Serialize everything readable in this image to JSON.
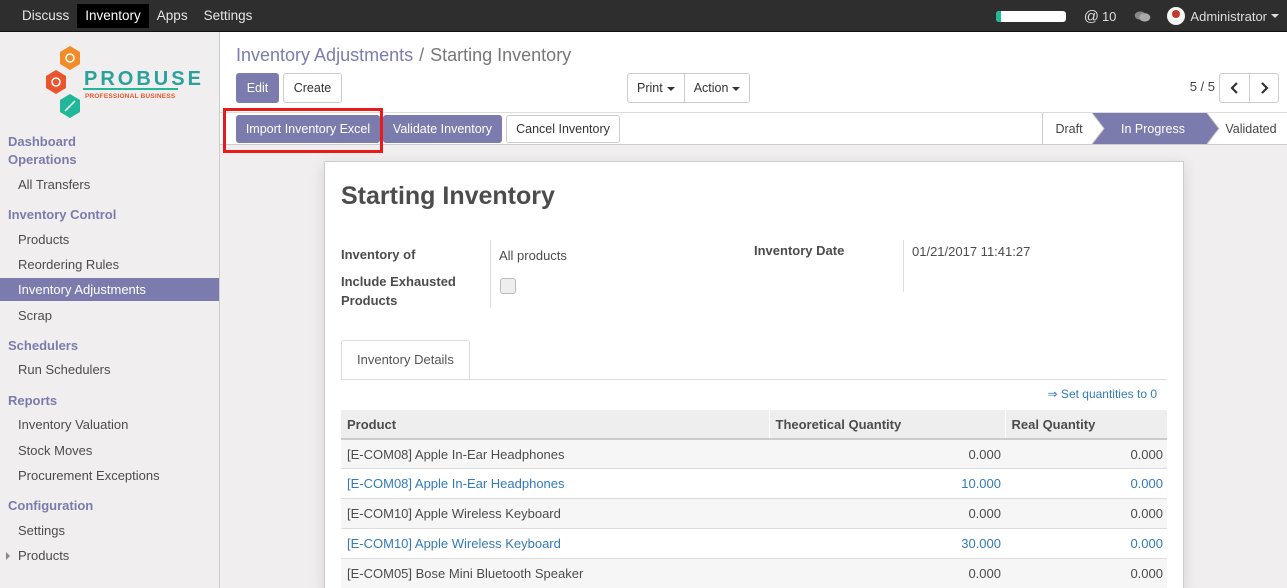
{
  "topbar": {
    "menu": [
      "Discuss",
      "Inventory",
      "Apps",
      "Settings"
    ],
    "active_menu": "Inventory",
    "progress_fraction": 0.08,
    "mentions_count": "10",
    "user_name": "Administrator"
  },
  "logo": {
    "name": "PROBUSE",
    "tagline": "PROFESSIONAL BUSINESS"
  },
  "sidebar": {
    "dashboard_heading": "Dashboard",
    "operations_heading": "Operations",
    "all_transfers": "All Transfers",
    "inventory_control_heading": "Inventory Control",
    "products": "Products",
    "reordering_rules": "Reordering Rules",
    "inventory_adjustments": "Inventory Adjustments",
    "scrap": "Scrap",
    "schedulers_heading": "Schedulers",
    "run_schedulers": "Run Schedulers",
    "reports_heading": "Reports",
    "inventory_valuation": "Inventory Valuation",
    "stock_moves": "Stock Moves",
    "procurement_exceptions": "Procurement Exceptions",
    "configuration_heading": "Configuration",
    "settings": "Settings",
    "config_products": "Products"
  },
  "breadcrumb": {
    "parent": "Inventory Adjustments",
    "separator": "/",
    "current": "Starting Inventory"
  },
  "toolbar": {
    "edit": "Edit",
    "create": "Create",
    "print": "Print",
    "action": "Action",
    "pager": "5 / 5"
  },
  "statusbar": {
    "import_excel": "Import Inventory Excel",
    "validate": "Validate Inventory",
    "cancel": "Cancel Inventory",
    "stages": [
      "Draft",
      "In Progress",
      "Validated"
    ],
    "active_stage": "In Progress",
    "highlight_color": "#e81a1a"
  },
  "form": {
    "title": "Starting Inventory",
    "inventory_of_label": "Inventory of",
    "inventory_of_value": "All products",
    "include_exhausted_label": "Include Exhausted Products",
    "include_exhausted_checked": false,
    "inventory_date_label": "Inventory Date",
    "inventory_date_value": "01/21/2017 11:41:27",
    "tab_label": "Inventory Details",
    "set_quantities_link": "⇒ Set quantities to 0"
  },
  "lines": {
    "headers": [
      "Product",
      "Theoretical Quantity",
      "Real Quantity"
    ],
    "rows": [
      {
        "product": "[E-COM08] Apple In-Ear Headphones",
        "theoretical": "0.000",
        "real": "0.000",
        "highlight": false
      },
      {
        "product": "[E-COM08] Apple In-Ear Headphones",
        "theoretical": "10.000",
        "real": "0.000",
        "highlight": true
      },
      {
        "product": "[E-COM10] Apple Wireless Keyboard",
        "theoretical": "0.000",
        "real": "0.000",
        "highlight": false
      },
      {
        "product": "[E-COM10] Apple Wireless Keyboard",
        "theoretical": "30.000",
        "real": "0.000",
        "highlight": true
      },
      {
        "product": "[E-COM05] Bose Mini Bluetooth Speaker",
        "theoretical": "0.000",
        "real": "0.000",
        "highlight": false
      }
    ]
  },
  "colors": {
    "accent": "#7c7bad",
    "link": "#337ab7",
    "topbar": "#2e2e2e",
    "progress_fill": "#21b799"
  }
}
